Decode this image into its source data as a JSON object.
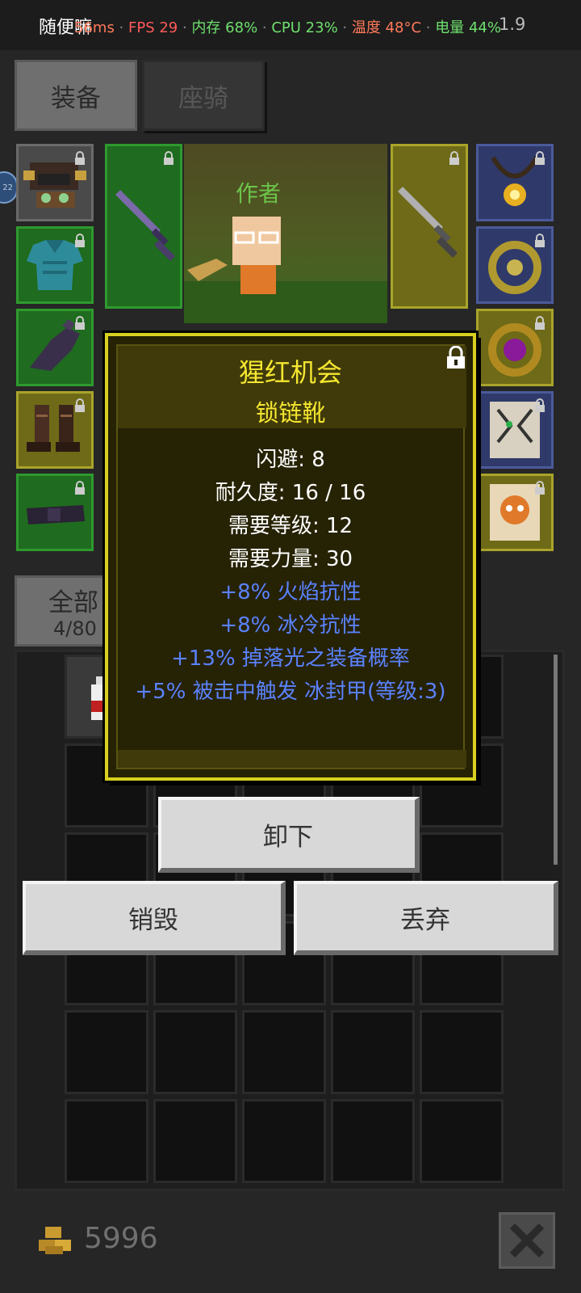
{
  "status": {
    "app_name": "随便嘛",
    "ping": "56ms",
    "fps": "FPS 29",
    "memory": "内存 68%",
    "cpu": "CPU 23%",
    "temperature": "温度 48°C",
    "battery": "电量 44%",
    "version": "1.9"
  },
  "tabs": [
    {
      "label": "装备",
      "active": true
    },
    {
      "label": "座骑",
      "active": false
    }
  ],
  "side_badge": "22",
  "character": {
    "name_tag": "作者"
  },
  "equipment": {
    "left": [
      {
        "icon": "helmet-icon",
        "rarity": "gray"
      },
      {
        "icon": "armor-icon",
        "rarity": "green"
      },
      {
        "icon": "gloves-icon",
        "rarity": "green"
      },
      {
        "icon": "boots-icon",
        "rarity": "yellow"
      },
      {
        "icon": "belt-icon",
        "rarity": "green"
      }
    ],
    "right": [
      {
        "icon": "amulet-icon",
        "rarity": "blue"
      },
      {
        "icon": "ring-icon",
        "rarity": "blue"
      },
      {
        "icon": "ring-gem-icon",
        "rarity": "yellow"
      },
      {
        "icon": "tiger-card-icon",
        "rarity": "blue"
      },
      {
        "icon": "pet-card-icon",
        "rarity": "yellow"
      }
    ],
    "weapon_main": {
      "icon": "purple-sword-icon",
      "rarity": "green"
    },
    "weapon_off": {
      "icon": "silver-sword-icon",
      "rarity": "yellow"
    }
  },
  "inventory": {
    "filter_label": "全部",
    "count": "4/80"
  },
  "tooltip": {
    "name": "猩红机会",
    "type": "锁链靴",
    "stats": [
      "闪避: 8",
      "耐久度: 16 / 16",
      "需要等级: 12",
      "需要力量: 30"
    ],
    "bonuses": [
      "+8% 火焰抗性",
      "+8% 冰冷抗性",
      "+13% 掉落光之装备概率",
      "+5% 被击中触发 冰封甲(等级:3)"
    ]
  },
  "actions": {
    "unequip": "卸下",
    "destroy": "销毁",
    "discard": "丢弃"
  },
  "footer": {
    "gold": "5996"
  },
  "colors": {
    "item_name": "#f5e630",
    "bonus_text": "#5a82ff",
    "tooltip_border": "#d8d020"
  }
}
